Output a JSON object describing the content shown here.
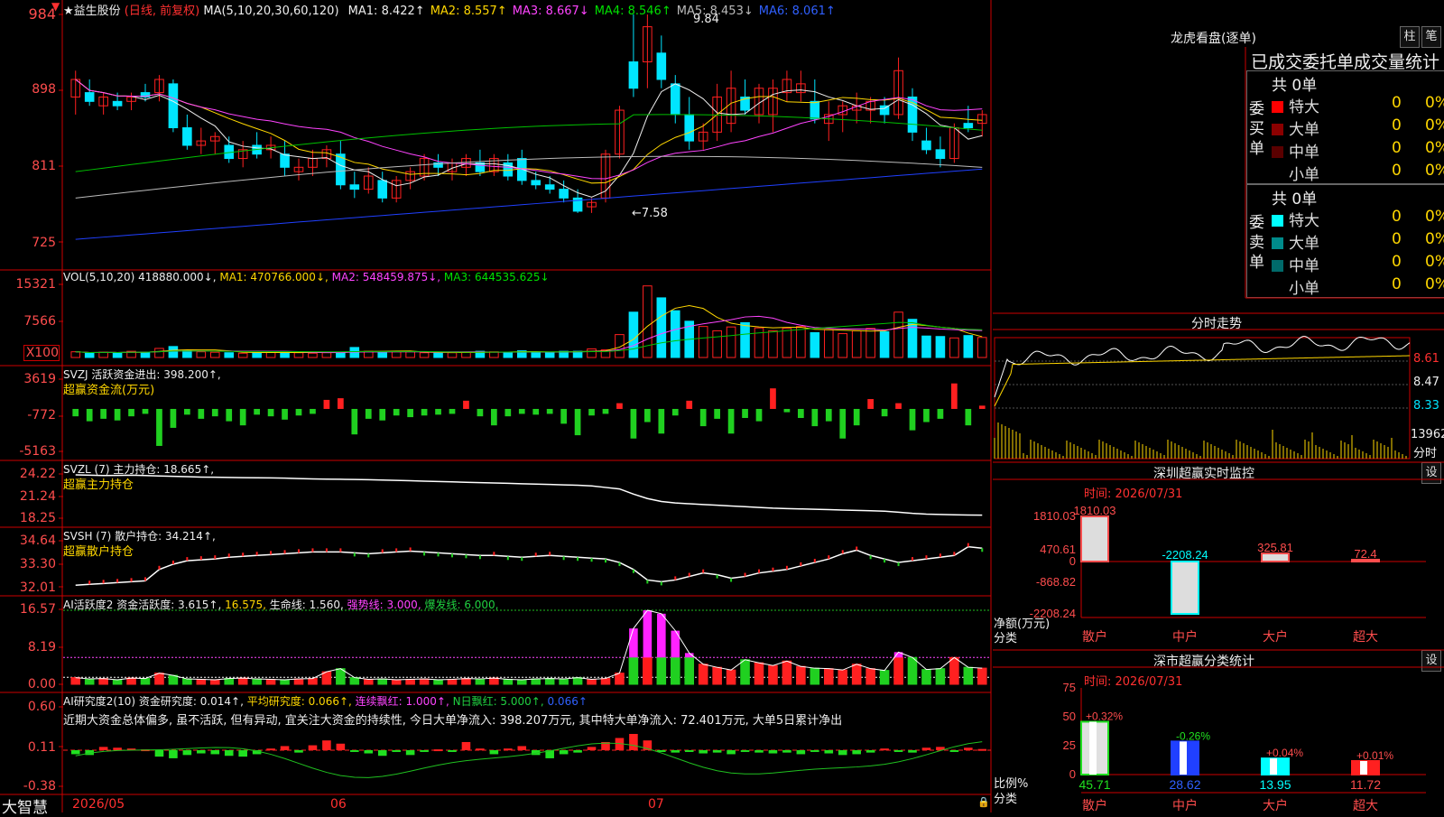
{
  "stock": {
    "name": "★益生股份",
    "period": "(日线, 前复权)",
    "ma_header": "MA(5,10,20,30,60,120)",
    "ma_items": [
      {
        "label": "MA1:",
        "value": "8.422↑",
        "color": "#eeeeee"
      },
      {
        "label": "MA2:",
        "value": "8.557↑",
        "color": "#ffd700"
      },
      {
        "label": "MA3:",
        "value": "8.667↓",
        "color": "#ff44ff"
      },
      {
        "label": "MA4:",
        "value": "8.546↑",
        "color": "#00e000"
      },
      {
        "label": "MA5:",
        "value": "8.453↓",
        "color": "#bbbbbb"
      },
      {
        "label": "MA6:",
        "value": "8.061↑",
        "color": "#3060ff"
      }
    ],
    "high_label": "9.84",
    "low_label": "←7.58",
    "axis": [
      "984",
      "898",
      "811",
      "725"
    ]
  },
  "vol": {
    "header": "VOL(5,10,20)",
    "value": "418880.000↓,",
    "ma1": "MA1: 470766.000↓,",
    "ma2": "MA2: 548459.875↓,",
    "ma3": "MA3: 644535.625↓",
    "axis": [
      "15321",
      "7566",
      "X100"
    ]
  },
  "svzj": {
    "header": "SVZJ  活跃资金进出: 398.200↑,",
    "sub": "超赢资金流(万元)",
    "axis": [
      "3619",
      "-772",
      "-5163"
    ]
  },
  "svzl": {
    "header": "SVZL (7) 主力持仓: 18.665↑,",
    "sub": "超赢主力持仓",
    "axis": [
      "24.22",
      "21.24",
      "18.25"
    ]
  },
  "svsh": {
    "header": "SVSH (7) 散户持仓: 34.214↑,",
    "sub": "超赢散户持仓",
    "axis": [
      "34.64",
      "33.30",
      "32.01"
    ]
  },
  "ai_active": {
    "header": "AI活跃度2 资金活跃度: 3.615↑,",
    "v2": "16.575,",
    "life": "生命线: 1.560,",
    "strong": "强势线: 3.000,",
    "burst": "爆发线: 6.000,",
    "axis": [
      "16.57",
      "8.19",
      "0.00"
    ]
  },
  "ai_research": {
    "header": "AI研究度2(10) 资金研究度: 0.014↑,",
    "avg": "平均研究度: 0.066↑,",
    "cont": "连续飘红: 1.000↑,",
    "nday": "N日飘红: 5.000↑,",
    "last": "0.066↑",
    "comment": "近期大资金总体偏多, 虽不活跃, 但有异动, 宜关注大资金的持续性, 今日大单净流入: 398.207万元, 其中特大单净流入: 72.401万元, 大单5日累计净出",
    "axis": [
      "0.60",
      "0.11",
      "-0.38"
    ]
  },
  "footer": {
    "brand": "大智慧",
    "dates": [
      "2026/05",
      "06",
      "07"
    ]
  },
  "longhu": {
    "title": "龙虎看盘(逐单)",
    "btn1": "柱",
    "btn2": "笔",
    "subtitle": "已成交委托单成交量统计",
    "buy_label": "委买单",
    "sell_label": "委卖单",
    "buy_total": "共 0单",
    "sell_total": "共 0单",
    "rows": [
      "特大",
      "大单",
      "中单",
      "小单"
    ],
    "zero": "0",
    "pct": "0%",
    "buy_colors": [
      "#ff0000",
      "#8b0000",
      "#5a0000",
      ""
    ],
    "sell_colors": [
      "#00ffff",
      "#008b8b",
      "#006a6a",
      ""
    ]
  },
  "fenshi": {
    "title": "分时走势",
    "axis": [
      "8.61",
      "8.47",
      "8.33"
    ],
    "vol_label": "13962",
    "unit": "分时"
  },
  "sz_monitor": {
    "title": "深圳超赢实时监控",
    "set": "设",
    "time": "时间: 2026/07/31",
    "axis": [
      "1810.03",
      "470.61",
      "0",
      "-868.82",
      "-2208.24"
    ],
    "ylabel": "净额(万元)",
    "xlabel": "分类",
    "categories": [
      "散户",
      "中户",
      "大户",
      "超大"
    ],
    "values": [
      1810.03,
      -2208.24,
      325.81,
      72.4
    ],
    "value_labels": [
      "1810.03",
      "-2208.24",
      "325.81",
      "72.4"
    ]
  },
  "sz_class": {
    "title": "深市超赢分类统计",
    "set": "设",
    "time": "时间: 2026/07/31",
    "axis": [
      "75",
      "50",
      "25",
      "0"
    ],
    "ylabel": "比例%",
    "xlabel": "分类",
    "categories": [
      "散户",
      "中户",
      "大户",
      "超大"
    ],
    "values": [
      45.71,
      28.62,
      13.95,
      11.72
    ],
    "value_labels": [
      "45.71",
      "28.62",
      "13.95",
      "11.72"
    ],
    "change_labels": [
      "+0.32%",
      "-0.26%",
      "+0.04%",
      "+0.01%"
    ]
  },
  "chart_data": [
    {
      "type": "candlestick",
      "title": "★益生股份 (日线, 前复权)",
      "ylim": [
        7.25,
        9.84
      ],
      "ohlc": [
        [
          8.9,
          9.2,
          8.7,
          9.1
        ],
        [
          8.95,
          9.1,
          8.8,
          8.85
        ],
        [
          8.8,
          8.95,
          8.7,
          8.9
        ],
        [
          8.85,
          8.95,
          8.75,
          8.8
        ],
        [
          8.85,
          8.95,
          8.75,
          8.9
        ],
        [
          8.95,
          9.05,
          8.85,
          8.9
        ],
        [
          8.95,
          9.15,
          8.85,
          9.1
        ],
        [
          9.05,
          9.1,
          8.5,
          8.55
        ],
        [
          8.55,
          8.7,
          8.3,
          8.35
        ],
        [
          8.35,
          8.55,
          8.25,
          8.4
        ],
        [
          8.4,
          8.5,
          8.25,
          8.45
        ],
        [
          8.35,
          8.45,
          8.15,
          8.2
        ],
        [
          8.2,
          8.4,
          8.1,
          8.3
        ],
        [
          8.35,
          8.5,
          8.2,
          8.25
        ],
        [
          8.3,
          8.45,
          8.2,
          8.35
        ],
        [
          8.25,
          8.4,
          8.0,
          8.1
        ],
        [
          8.05,
          8.2,
          7.95,
          8.1
        ],
        [
          8.1,
          8.3,
          8.0,
          8.2
        ],
        [
          8.2,
          8.35,
          8.1,
          8.3
        ],
        [
          8.25,
          8.4,
          7.85,
          7.9
        ],
        [
          7.9,
          8.05,
          7.75,
          7.85
        ],
        [
          7.85,
          8.1,
          7.8,
          8.0
        ],
        [
          7.95,
          8.05,
          7.7,
          7.75
        ],
        [
          7.75,
          8.0,
          7.7,
          7.95
        ],
        [
          7.95,
          8.1,
          7.85,
          8.05
        ],
        [
          8.0,
          8.25,
          7.95,
          8.2
        ],
        [
          8.15,
          8.25,
          8.0,
          8.1
        ],
        [
          8.05,
          8.2,
          7.95,
          8.15
        ],
        [
          8.1,
          8.25,
          8.0,
          8.2
        ],
        [
          8.15,
          8.3,
          8.0,
          8.05
        ],
        [
          8.05,
          8.25,
          8.0,
          8.2
        ],
        [
          8.15,
          8.25,
          7.95,
          8.0
        ],
        [
          8.2,
          8.3,
          7.9,
          7.95
        ],
        [
          7.95,
          8.05,
          7.85,
          7.9
        ],
        [
          7.9,
          8.0,
          7.8,
          7.85
        ],
        [
          7.85,
          7.95,
          7.7,
          7.75
        ],
        [
          7.75,
          7.85,
          7.58,
          7.6
        ],
        [
          7.65,
          7.75,
          7.58,
          7.7
        ],
        [
          7.75,
          8.3,
          7.7,
          8.25
        ],
        [
          8.25,
          8.8,
          8.2,
          8.75
        ],
        [
          9.3,
          9.84,
          8.9,
          9.0
        ],
        [
          9.3,
          9.84,
          9.0,
          9.7
        ],
        [
          9.4,
          9.6,
          9.0,
          9.1
        ],
        [
          9.05,
          9.15,
          8.6,
          8.7
        ],
        [
          8.7,
          8.9,
          8.3,
          8.4
        ],
        [
          8.4,
          8.6,
          8.3,
          8.5
        ],
        [
          8.5,
          9.05,
          8.4,
          8.9
        ],
        [
          8.6,
          9.2,
          8.5,
          9.0
        ],
        [
          8.9,
          9.1,
          8.7,
          8.75
        ],
        [
          8.7,
          9.05,
          8.6,
          9.0
        ],
        [
          8.7,
          9.1,
          8.5,
          9.0
        ],
        [
          8.95,
          9.2,
          8.85,
          9.1
        ],
        [
          8.95,
          9.2,
          8.85,
          9.05
        ],
        [
          8.85,
          9.1,
          8.6,
          8.65
        ],
        [
          8.6,
          8.85,
          8.4,
          8.7
        ],
        [
          8.7,
          8.85,
          8.5,
          8.8
        ],
        [
          8.75,
          8.95,
          8.6,
          8.8
        ],
        [
          8.75,
          8.9,
          8.6,
          8.85
        ],
        [
          8.8,
          8.9,
          8.6,
          8.7
        ],
        [
          8.7,
          9.35,
          8.65,
          9.2
        ],
        [
          8.9,
          9.0,
          8.4,
          8.5
        ],
        [
          8.4,
          8.55,
          8.25,
          8.3
        ],
        [
          8.3,
          8.45,
          8.1,
          8.2
        ],
        [
          8.2,
          8.6,
          8.15,
          8.55
        ],
        [
          8.6,
          8.8,
          8.5,
          8.55
        ],
        [
          8.6,
          8.75,
          8.45,
          8.7
        ]
      ]
    },
    {
      "type": "bar",
      "title": "VOL(5,10,20)",
      "ylim": [
        0,
        15321
      ],
      "values": [
        1200,
        900,
        1100,
        1000,
        1300,
        1100,
        1900,
        2300,
        1400,
        1200,
        1100,
        1000,
        900,
        1000,
        1200,
        1100,
        1000,
        900,
        1000,
        1100,
        2100,
        1300,
        1000,
        1200,
        1200,
        1000,
        900,
        1000,
        1100,
        1300,
        1200,
        1100,
        1400,
        1100,
        1000,
        1300,
        1300,
        1800,
        1600,
        4800,
        9500,
        15000,
        12500,
        9800,
        7600,
        6500,
        5600,
        6400,
        7300,
        6200,
        5600,
        6100,
        6500,
        5200,
        5800,
        5000,
        5600,
        6100,
        5400,
        9500,
        8000,
        4500,
        4400,
        4100,
        4600,
        4200
      ]
    },
    {
      "type": "bar",
      "title": "SVZJ 活跃资金进出",
      "ylim": [
        -5163,
        3619
      ],
      "values": [
        -900,
        -1500,
        -1200,
        -1400,
        -900,
        -600,
        -4500,
        -2300,
        -700,
        -1200,
        -900,
        -1500,
        -2000,
        -700,
        -900,
        -1300,
        -800,
        -600,
        1100,
        1300,
        -3100,
        -1200,
        -1400,
        -800,
        -1000,
        -800,
        -700,
        -600,
        1000,
        -900,
        -2000,
        -900,
        -600,
        -700,
        -600,
        -1800,
        -3200,
        -800,
        -600,
        700,
        -3600,
        -1600,
        -3000,
        -800,
        1000,
        -2100,
        -1200,
        -3000,
        -1100,
        -1500,
        2500,
        -400,
        -1100,
        -2100,
        -1500,
        -3600,
        -2000,
        1200,
        -900,
        700,
        -2600,
        -1600,
        -1200,
        3100,
        -2000,
        398
      ]
    },
    {
      "type": "line",
      "title": "SVZL (7) 主力持仓",
      "ylim": [
        18.25,
        24.22
      ],
      "values": [
        24.1,
        24.05,
        24.0,
        24.02,
        24.05,
        24.0,
        23.95,
        23.9,
        23.85,
        23.8,
        23.78,
        23.75,
        23.72,
        23.7,
        23.68,
        23.65,
        23.6,
        23.55,
        23.52,
        23.5,
        23.48,
        23.45,
        23.4,
        23.35,
        23.3,
        23.25,
        23.2,
        23.15,
        23.1,
        23.05,
        23.0,
        22.95,
        22.9,
        22.85,
        22.8,
        22.75,
        22.7,
        22.6,
        22.4,
        22.2,
        21.5,
        20.9,
        20.5,
        20.3,
        20.2,
        20.1,
        20.0,
        19.9,
        19.8,
        19.7,
        19.6,
        19.55,
        19.5,
        19.45,
        19.4,
        19.35,
        19.3,
        19.25,
        19.2,
        19.05,
        18.9,
        18.8,
        18.75,
        18.7,
        18.68,
        18.665
      ]
    },
    {
      "type": "line",
      "title": "SVSH (7) 散户持仓",
      "ylim": [
        32.01,
        34.64
      ],
      "values": [
        32.1,
        32.15,
        32.2,
        32.25,
        32.3,
        32.35,
        33.0,
        33.3,
        33.5,
        33.55,
        33.6,
        33.7,
        33.75,
        33.8,
        33.85,
        33.9,
        33.95,
        34.0,
        34.0,
        34.0,
        33.95,
        33.9,
        33.95,
        34.0,
        34.05,
        34.0,
        33.95,
        33.9,
        33.85,
        33.8,
        33.8,
        33.75,
        33.7,
        33.75,
        33.8,
        33.75,
        33.7,
        33.65,
        33.6,
        33.4,
        33.0,
        32.4,
        32.3,
        32.4,
        32.6,
        32.8,
        32.7,
        32.5,
        32.6,
        32.8,
        32.9,
        33.0,
        33.2,
        33.4,
        33.6,
        33.9,
        34.1,
        33.8,
        33.6,
        33.4,
        33.5,
        33.6,
        33.7,
        33.8,
        34.3,
        34.214
      ]
    },
    {
      "type": "bar",
      "title": "AI活跃度2",
      "ylim": [
        0,
        16.57
      ],
      "values": [
        1.5,
        1.2,
        1.3,
        1.0,
        1.4,
        1.3,
        2.5,
        2.0,
        1.2,
        1.1,
        1.0,
        1.3,
        1.4,
        1.2,
        1.1,
        1.0,
        1.2,
        1.3,
        2.8,
        3.5,
        1.5,
        1.1,
        1.2,
        1.0,
        1.1,
        1.2,
        1.0,
        1.1,
        1.3,
        1.2,
        1.4,
        1.1,
        1.0,
        1.2,
        1.3,
        1.2,
        1.5,
        1.1,
        1.3,
        2.5,
        12.5,
        16.57,
        15.8,
        12.0,
        7.0,
        4.5,
        3.8,
        3.2,
        5.5,
        4.8,
        4.2,
        5.2,
        4.0,
        3.6,
        3.5,
        3.2,
        4.5,
        3.5,
        3.1,
        7.2,
        6.0,
        3.3,
        3.5,
        6.0,
        3.8,
        3.615
      ]
    },
    {
      "type": "bar",
      "title": "AI研究度2(10)",
      "ylim": [
        -0.38,
        0.6
      ],
      "values": [
        -0.05,
        -0.06,
        0.04,
        0.03,
        0.02,
        0.01,
        -0.08,
        -0.1,
        -0.06,
        -0.04,
        -0.05,
        -0.07,
        -0.08,
        -0.05,
        0.02,
        0.05,
        -0.03,
        0.06,
        0.12,
        0.08,
        -0.02,
        -0.04,
        -0.07,
        -0.02,
        -0.06,
        -0.02,
        0.01,
        -0.02,
        0.1,
        0.02,
        -0.05,
        0.02,
        0.05,
        -0.06,
        -0.1,
        -0.05,
        -0.03,
        0.04,
        0.1,
        0.15,
        0.2,
        0.12,
        -0.02,
        -0.03,
        -0.02,
        -0.04,
        -0.03,
        -0.05,
        -0.02,
        -0.03,
        -0.04,
        -0.03,
        -0.05,
        -0.02,
        -0.04,
        -0.06,
        -0.05,
        -0.03,
        0.02,
        -0.02,
        -0.03,
        0.03,
        0.04,
        -0.02,
        0.03,
        0.014
      ]
    },
    {
      "type": "bar",
      "title": "深圳超赢实时监控",
      "categories": [
        "散户",
        "中户",
        "大户",
        "超大"
      ],
      "values": [
        1810.03,
        -2208.24,
        325.81,
        72.4
      ],
      "ylabel": "净额(万元)",
      "xlabel": "分类",
      "ylim": [
        -2208.24,
        1810.03
      ]
    },
    {
      "type": "bar",
      "title": "深市超赢分类统计",
      "categories": [
        "散户",
        "中户",
        "大户",
        "超大"
      ],
      "values": [
        45.71,
        28.62,
        13.95,
        11.72
      ],
      "ylabel": "比例%",
      "xlabel": "分类",
      "ylim": [
        0,
        75
      ]
    }
  ]
}
